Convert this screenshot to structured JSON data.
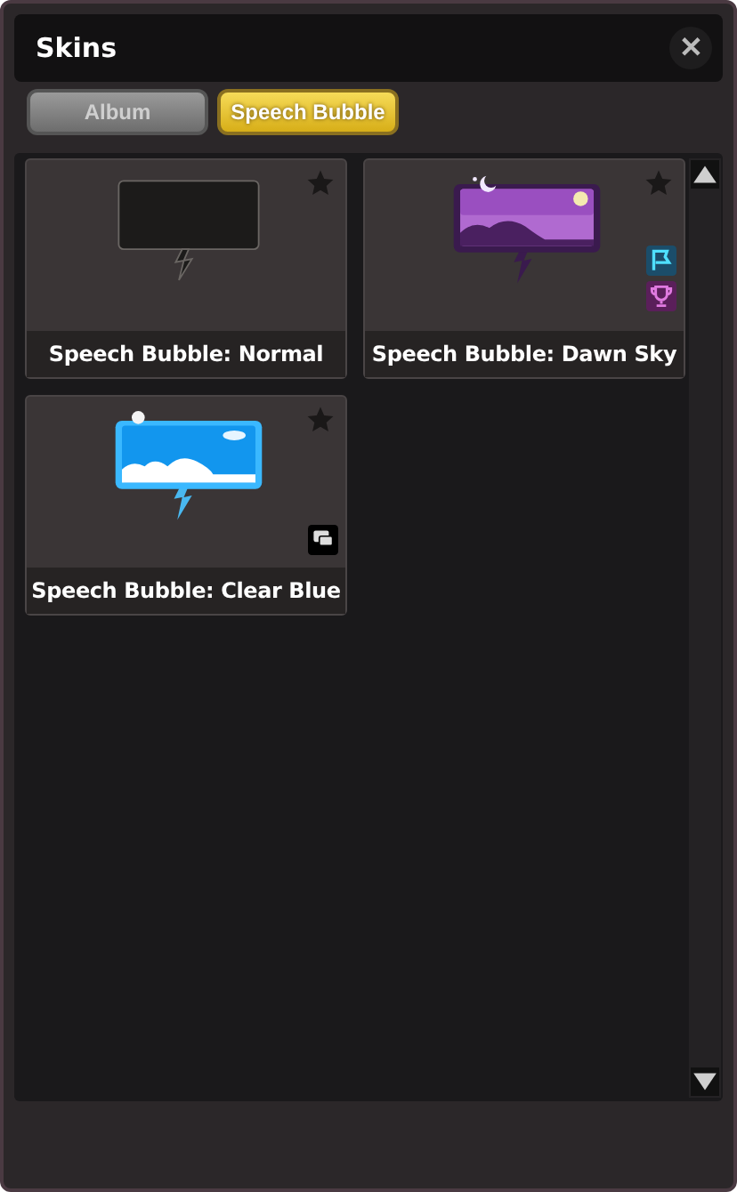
{
  "window": {
    "title": "Skins",
    "close": "✕"
  },
  "tabs": [
    {
      "label": "Album",
      "selected": false
    },
    {
      "label": "Speech Bubble",
      "selected": true
    }
  ],
  "skins": [
    {
      "name": "Speech Bubble: Normal",
      "kind": "normal"
    },
    {
      "name": "Speech Bubble: Dawn Sky",
      "kind": "dawn",
      "badges": [
        {
          "kind": "flag"
        },
        {
          "kind": "trophy"
        }
      ]
    },
    {
      "name": "Speech Bubble: Clear Blue",
      "kind": "clear",
      "badges": [
        {
          "kind": "chat"
        }
      ]
    }
  ]
}
